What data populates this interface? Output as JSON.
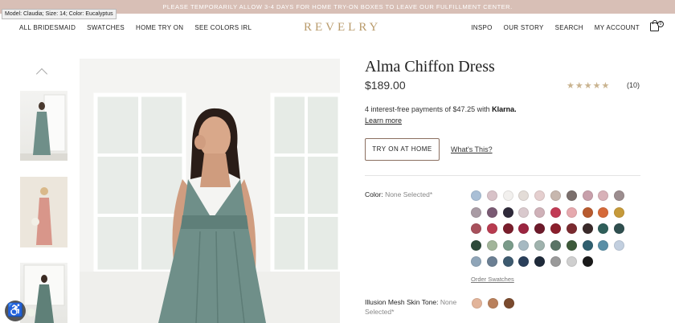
{
  "promo": {
    "text": "PLEASE TEMPORARILY ALLOW 3-4 DAYS FOR HOME TRY-ON BOXES TO LEAVE OUR FULFILLMENT CENTER."
  },
  "tooltip": {
    "text": "Model: Claudia; Size: 14; Color: Eucalyptus"
  },
  "nav": {
    "left": [
      "ALL BRIDESMAID",
      "SWATCHES",
      "HOME TRY ON",
      "SEE COLORS IRL"
    ],
    "logo": "REVELRY",
    "right": [
      "INSPO",
      "OUR STORY",
      "SEARCH",
      "MY ACCOUNT"
    ],
    "bag_count": "0"
  },
  "product": {
    "title": "Alma Chiffon Dress",
    "price": "$189.00",
    "stars": "★★★★★",
    "rating": 4.5,
    "reviews": "(10)",
    "klarna_text": "4 interest-free payments of $47.25 with",
    "klarna_brand": "Klarna.",
    "learn_more": "Learn more",
    "try_on_button": "TRY ON AT HOME",
    "whats_this": "What's This?",
    "color_label": "Color:",
    "color_value": "None Selected*",
    "order_swatches": "Order Swatches",
    "mesh_label": "Illusion Mesh Skin Tone:",
    "mesh_value": "None Selected*"
  },
  "colors": {
    "accent": "#b99b6b",
    "promo_bg": "#d8bfb6",
    "dress": "#6f8f89",
    "swatch_rows": [
      [
        "#a9bfd6",
        "#d8c2c8",
        "#f2f0ee",
        "#e3dcd7",
        "#e5cfcf",
        "#c7b7ae",
        "#7b6f6c",
        "#c8a0ab",
        "#d8b1b8",
        "#9c8d8f"
      ],
      [
        "#a99ba4",
        "#7a5a73",
        "#2f2a3a",
        "#d9c9cd",
        "#cfb1b8",
        "#c23b55",
        "#e6a9ae",
        "#b85a2e",
        "#d56a3a",
        "#c69a3a"
      ],
      [
        "#a8515c",
        "#b83b50",
        "#7a1e2c",
        "#9b2540",
        "#6d1a2a",
        "#8b1f2c",
        "#7a2a2f",
        "#3a2a2a",
        "#2f5f5a",
        "#2f4f4f"
      ],
      [
        "#2e4a3a",
        "#a2b59a",
        "#7a9b8a",
        "#a6b9c2",
        "#9fb2ad",
        "#5a7466",
        "#3d5a3a",
        "#2f5f6f",
        "#5a8fa6",
        "#c2cfdf"
      ],
      [
        "#8fa5b8",
        "#6b7f93",
        "#3d5a6f",
        "#2a3f5a",
        "#1f2a3a",
        "#9a9a9a",
        "#cfcfcf",
        "#1a1a1a"
      ]
    ],
    "mesh_swatches": [
      "#e2b49a",
      "#b9805c",
      "#7a4a2e"
    ]
  }
}
